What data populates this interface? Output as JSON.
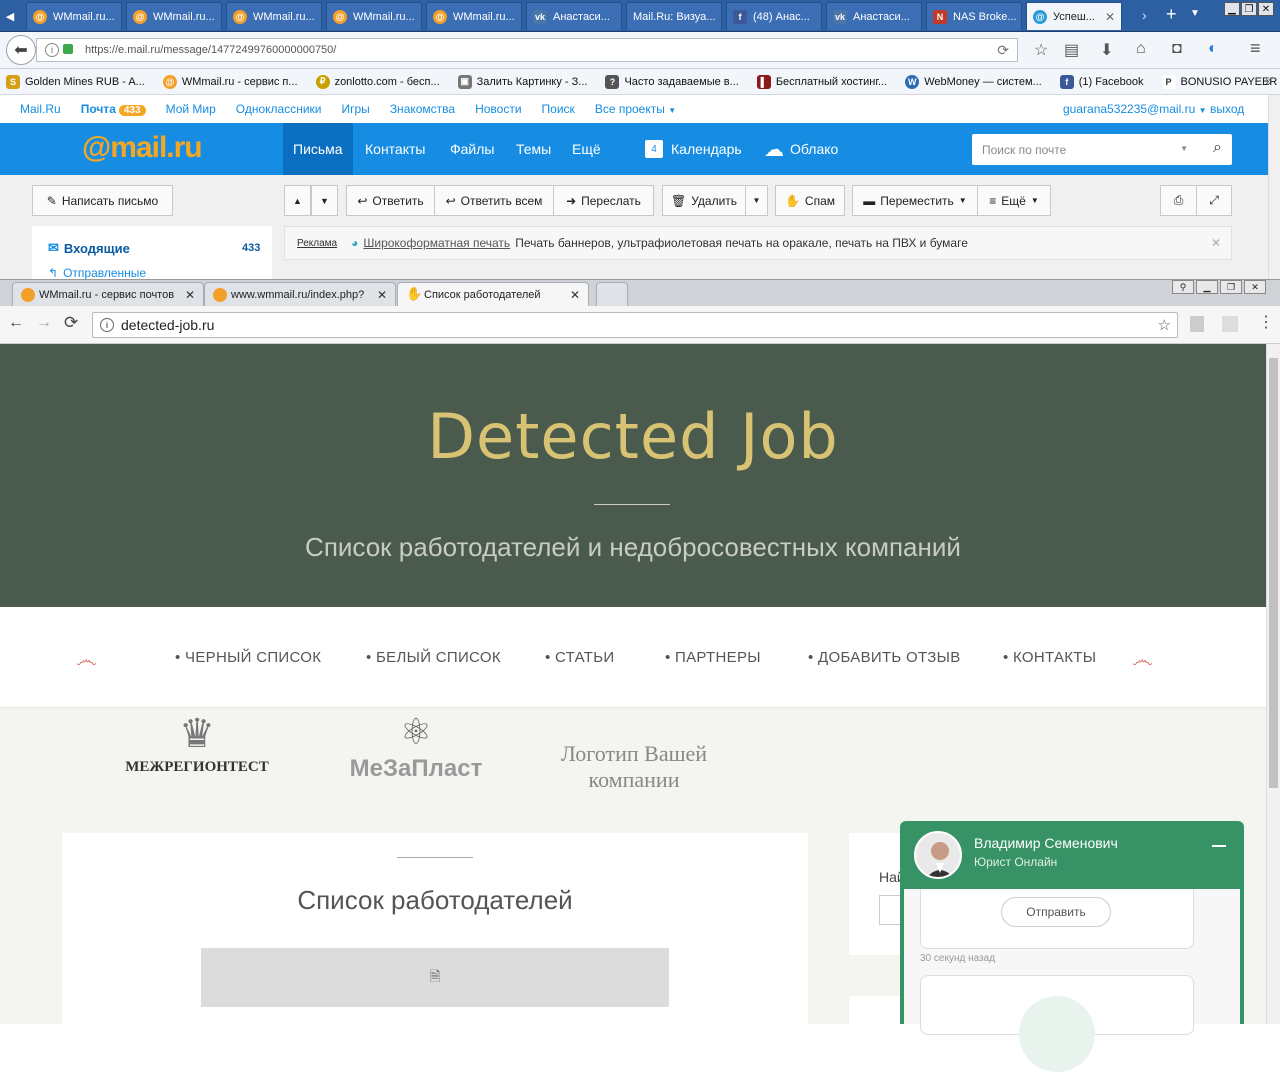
{
  "firefox": {
    "tabs": [
      {
        "label": "WMmail.ru..."
      },
      {
        "label": "WMmail.ru..."
      },
      {
        "label": "WMmail.ru..."
      },
      {
        "label": "WMmail.ru..."
      },
      {
        "label": "WMmail.ru..."
      },
      {
        "label": "Анастаси..."
      },
      {
        "label": "Mail.Ru: Визуа..."
      },
      {
        "label": "(48) Анас..."
      },
      {
        "label": "Анастаси..."
      },
      {
        "label": "NAS Broke..."
      },
      {
        "label": "Успеш..."
      }
    ],
    "url": "https://e.mail.ru/message/14772499760000000750/",
    "bookmarks": [
      {
        "label": "Golden Mines RUB - A...",
        "color": "#d4a017"
      },
      {
        "label": "WMmail.ru - сервис п...",
        "color": "#f3a02a"
      },
      {
        "label": "zonlotto.com - бесп...",
        "color": "#c8a000"
      },
      {
        "label": "Залить Картинку - З...",
        "color": "#777777"
      },
      {
        "label": "Часто задаваемые в...",
        "color": "#555555"
      },
      {
        "label": "Бесплатный хостинг...",
        "color": "#8b1a1a"
      },
      {
        "label": "WebMoney — систем...",
        "color": "#2a6db5"
      },
      {
        "label": "(1) Facebook",
        "color": "#3b5998"
      },
      {
        "label": "BONUSIO PAYEER BO...",
        "color": "#333333"
      }
    ]
  },
  "mailru": {
    "toplinks": [
      "Mail.Ru",
      "Почта",
      "Мой Мир",
      "Одноклассники",
      "Игры",
      "Знакомства",
      "Новости",
      "Поиск",
      "Все проекты"
    ],
    "mail_count": "433",
    "user": "guarana532235@mail.ru",
    "logout": "выход",
    "logo": "@mail.ru",
    "nav": [
      "Письма",
      "Контакты",
      "Файлы",
      "Темы",
      "Ещё",
      "Календарь",
      "Облако"
    ],
    "search_placeholder": "Поиск по почте",
    "compose": "Написать письмо",
    "actions": [
      "Ответить",
      "Ответить всем",
      "Переслать",
      "Удалить",
      "Спам",
      "Переместить",
      "Ещё"
    ],
    "folders": [
      {
        "label": "Входящие",
        "count": "433"
      },
      {
        "label": "Отправленные"
      }
    ],
    "ad": {
      "tag": "Реклама",
      "link": "Широкоформатная печать",
      "text": "Печать баннеров, ультрафиолетовая печать на оракале, печать на ПВХ и бумаге"
    }
  },
  "chrome": {
    "tabs": [
      "WMmail.ru - сервис почтов",
      "www.wmmail.ru/index.php?",
      "Список работодателей"
    ],
    "url": "detected-job.ru"
  },
  "site": {
    "title": "Detected Job",
    "subtitle": "Список работодателей и недобросовестных компаний",
    "menu": [
      "ЧЕРНЫЙ СПИСОК",
      "БЕЛЫЙ СПИСОК",
      "СТАТЬИ",
      "ПАРТНЕРЫ",
      "ДОБАВИТЬ ОТЗЫВ",
      "КОНТАКТЫ"
    ],
    "partners": [
      "МЕЖРЕГИОНТЕСТ",
      "МеЗаПласт",
      "Логотип Вашей компании"
    ],
    "section_title": "Список работодателей",
    "side_label": "Най"
  },
  "chat": {
    "name": "Владимир Семенович",
    "role": "Юрист Онлайн",
    "send": "Отправить",
    "ago": "30 секунд назад"
  },
  "colors": {
    "mail_blue": "#168de2",
    "mail_orange": "#f5a623",
    "hero_bg": "#4a5b4d",
    "hero_title": "#d8c374",
    "chat_green": "#379266"
  }
}
